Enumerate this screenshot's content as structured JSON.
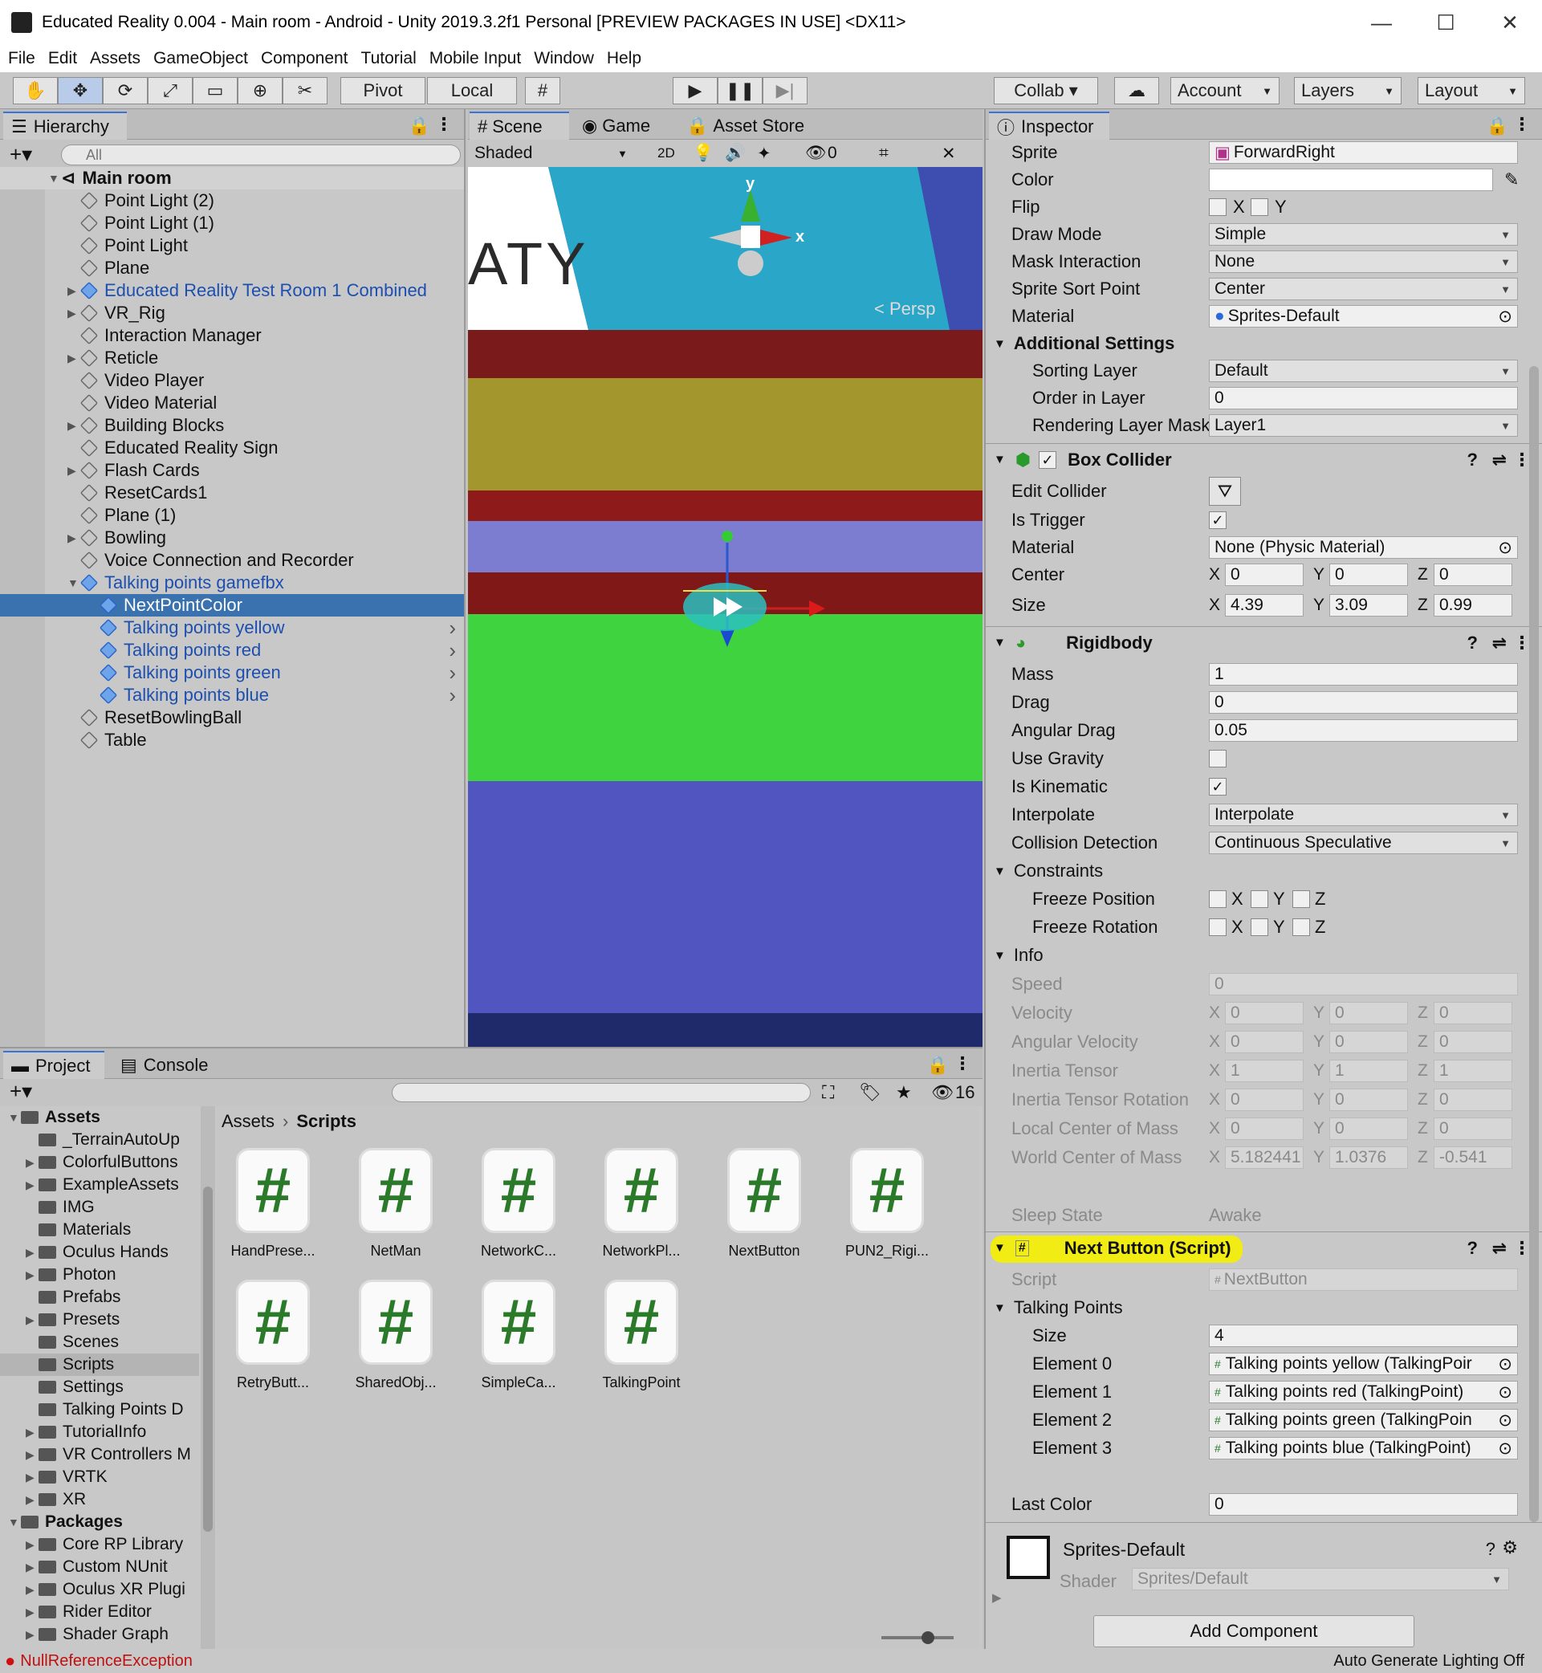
{
  "window": {
    "title": "Educated Reality 0.004 - Main room - Android - Unity 2019.3.2f1 Personal [PREVIEW PACKAGES IN USE] <DX11>"
  },
  "menu": [
    "File",
    "Edit",
    "Assets",
    "GameObject",
    "Component",
    "Tutorial",
    "Mobile Input",
    "Window",
    "Help"
  ],
  "toolbar": {
    "pivot": "Pivot",
    "local": "Local",
    "collab": "Collab",
    "account": "Account",
    "layers": "Layers",
    "layout": "Layout"
  },
  "hierarchy": {
    "tab": "Hierarchy",
    "search_placeholder": "All",
    "scene": "Main room",
    "items": [
      "Point Light (2)",
      "Point Light (1)",
      "Point Light",
      "Plane",
      "Educated Reality Test Room 1 Combined",
      "VR_Rig",
      "Interaction Manager",
      "Reticle",
      "Video Player",
      "Video Material",
      "Building Blocks",
      "Educated Reality Sign",
      "Flash Cards",
      "ResetCards1",
      "Plane (1)",
      "Bowling",
      "Voice Connection and Recorder",
      "Talking points gamefbx",
      "NextPointColor",
      "Talking points yellow",
      "Talking points red",
      "Talking points green",
      "Talking points blue",
      "ResetBowlingBall",
      "Table"
    ]
  },
  "scene": {
    "tabs": [
      "Scene",
      "Game",
      "Asset Store"
    ],
    "shading": "Shaded",
    "mode2d": "2D",
    "hidden_count": "0",
    "persp": "< Persp",
    "axis_y": "y",
    "axis_x": "x",
    "sign_text": "ATY"
  },
  "inspector": {
    "tab": "Inspector",
    "sprite": {
      "label": "Sprite",
      "value": "ForwardRight"
    },
    "color": {
      "label": "Color"
    },
    "flip": {
      "label": "Flip",
      "x": "X",
      "y": "Y"
    },
    "draw_mode": {
      "label": "Draw Mode",
      "value": "Simple"
    },
    "mask": {
      "label": "Mask Interaction",
      "value": "None"
    },
    "sort_point": {
      "label": "Sprite Sort Point",
      "value": "Center"
    },
    "material": {
      "label": "Material",
      "value": "Sprites-Default"
    },
    "additional": "Additional Settings",
    "sorting_layer": {
      "label": "Sorting Layer",
      "value": "Default"
    },
    "order": {
      "label": "Order in Layer",
      "value": "0"
    },
    "rlm": {
      "label": "Rendering Layer Mask",
      "value": "Layer1"
    },
    "box_collider": {
      "title": "Box Collider",
      "edit": "Edit Collider",
      "trigger": "Is Trigger",
      "material": {
        "label": "Material",
        "value": "None (Physic Material)"
      },
      "center": {
        "label": "Center",
        "x": "0",
        "y": "0",
        "z": "0"
      },
      "size": {
        "label": "Size",
        "x": "4.39",
        "y": "3.09",
        "z": "0.99"
      }
    },
    "rigidbody": {
      "title": "Rigidbody",
      "mass": {
        "label": "Mass",
        "value": "1"
      },
      "drag": {
        "label": "Drag",
        "value": "0"
      },
      "adrag": {
        "label": "Angular Drag",
        "value": "0.05"
      },
      "gravity": {
        "label": "Use Gravity"
      },
      "kinematic": {
        "label": "Is Kinematic"
      },
      "interp": {
        "label": "Interpolate",
        "value": "Interpolate"
      },
      "collision": {
        "label": "Collision Detection",
        "value": "Continuous Speculative"
      },
      "constraints": "Constraints",
      "freeze_pos": "Freeze Position",
      "freeze_rot": "Freeze Rotation",
      "info": "Info",
      "speed": {
        "label": "Speed",
        "value": "0"
      },
      "velocity": {
        "label": "Velocity",
        "x": "0",
        "y": "0",
        "z": "0"
      },
      "ang_vel": {
        "label": "Angular Velocity",
        "x": "0",
        "y": "0",
        "z": "0"
      },
      "inertia": {
        "label": "Inertia Tensor",
        "x": "1",
        "y": "1",
        "z": "1"
      },
      "inertia_rot": {
        "label": "Inertia Tensor Rotation",
        "x": "0",
        "y": "0",
        "z": "0"
      },
      "local_com": {
        "label": "Local Center of Mass",
        "x": "0",
        "y": "0",
        "z": "0"
      },
      "world_com": {
        "label": "World Center of Mass",
        "x": "5.182441",
        "y": "1.0376",
        "z": "-0.541"
      },
      "sleep": {
        "label": "Sleep State",
        "value": "Awake"
      }
    },
    "next_button": {
      "title": "Next Button (Script)",
      "script": {
        "label": "Script",
        "value": "NextButton"
      },
      "talking_points": "Talking Points",
      "size": {
        "label": "Size",
        "value": "4"
      },
      "elements": [
        {
          "label": "Element 0",
          "value": "Talking points yellow (TalkingPoir"
        },
        {
          "label": "Element 1",
          "value": "Talking points red (TalkingPoint)"
        },
        {
          "label": "Element 2",
          "value": "Talking points green (TalkingPoin"
        },
        {
          "label": "Element 3",
          "value": "Talking points blue (TalkingPoint)"
        }
      ],
      "last_color": {
        "label": "Last Color",
        "value": "0"
      }
    },
    "material_preview": {
      "name": "Sprites-Default",
      "shader_label": "Shader",
      "shader": "Sprites/Default"
    },
    "add_component": "Add Component"
  },
  "project": {
    "tabs": [
      "Project",
      "Console"
    ],
    "hidden_count": "16",
    "breadcrumb": [
      "Assets",
      "Scripts"
    ],
    "tree": [
      "Assets",
      "_TerrainAutoUp",
      "ColorfulButtons",
      "ExampleAssets",
      "IMG",
      "Materials",
      "Oculus Hands",
      "Photon",
      "Prefabs",
      "Presets",
      "Scenes",
      "Scripts",
      "Settings",
      "Talking Points D",
      "TutorialInfo",
      "VR Controllers M",
      "VRTK",
      "XR",
      "Packages",
      "Core RP Library",
      "Custom NUnit",
      "Oculus XR Plugi",
      "Rider Editor",
      "Shader Graph"
    ],
    "files": [
      "HandPrese...",
      "NetMan",
      "NetworkC...",
      "NetworkPl...",
      "NextButton",
      "PUN2_Rigi...",
      "RetryButt...",
      "SharedObj...",
      "SimpleCa...",
      "TalkingPoint"
    ]
  },
  "status": {
    "error": "NullReferenceException",
    "lighting": "Auto Generate Lighting Off"
  },
  "colors": {
    "selection": "#3a72b0",
    "highlight": "#f4f000",
    "accent": "#3a72d8",
    "error": "#d01010"
  }
}
